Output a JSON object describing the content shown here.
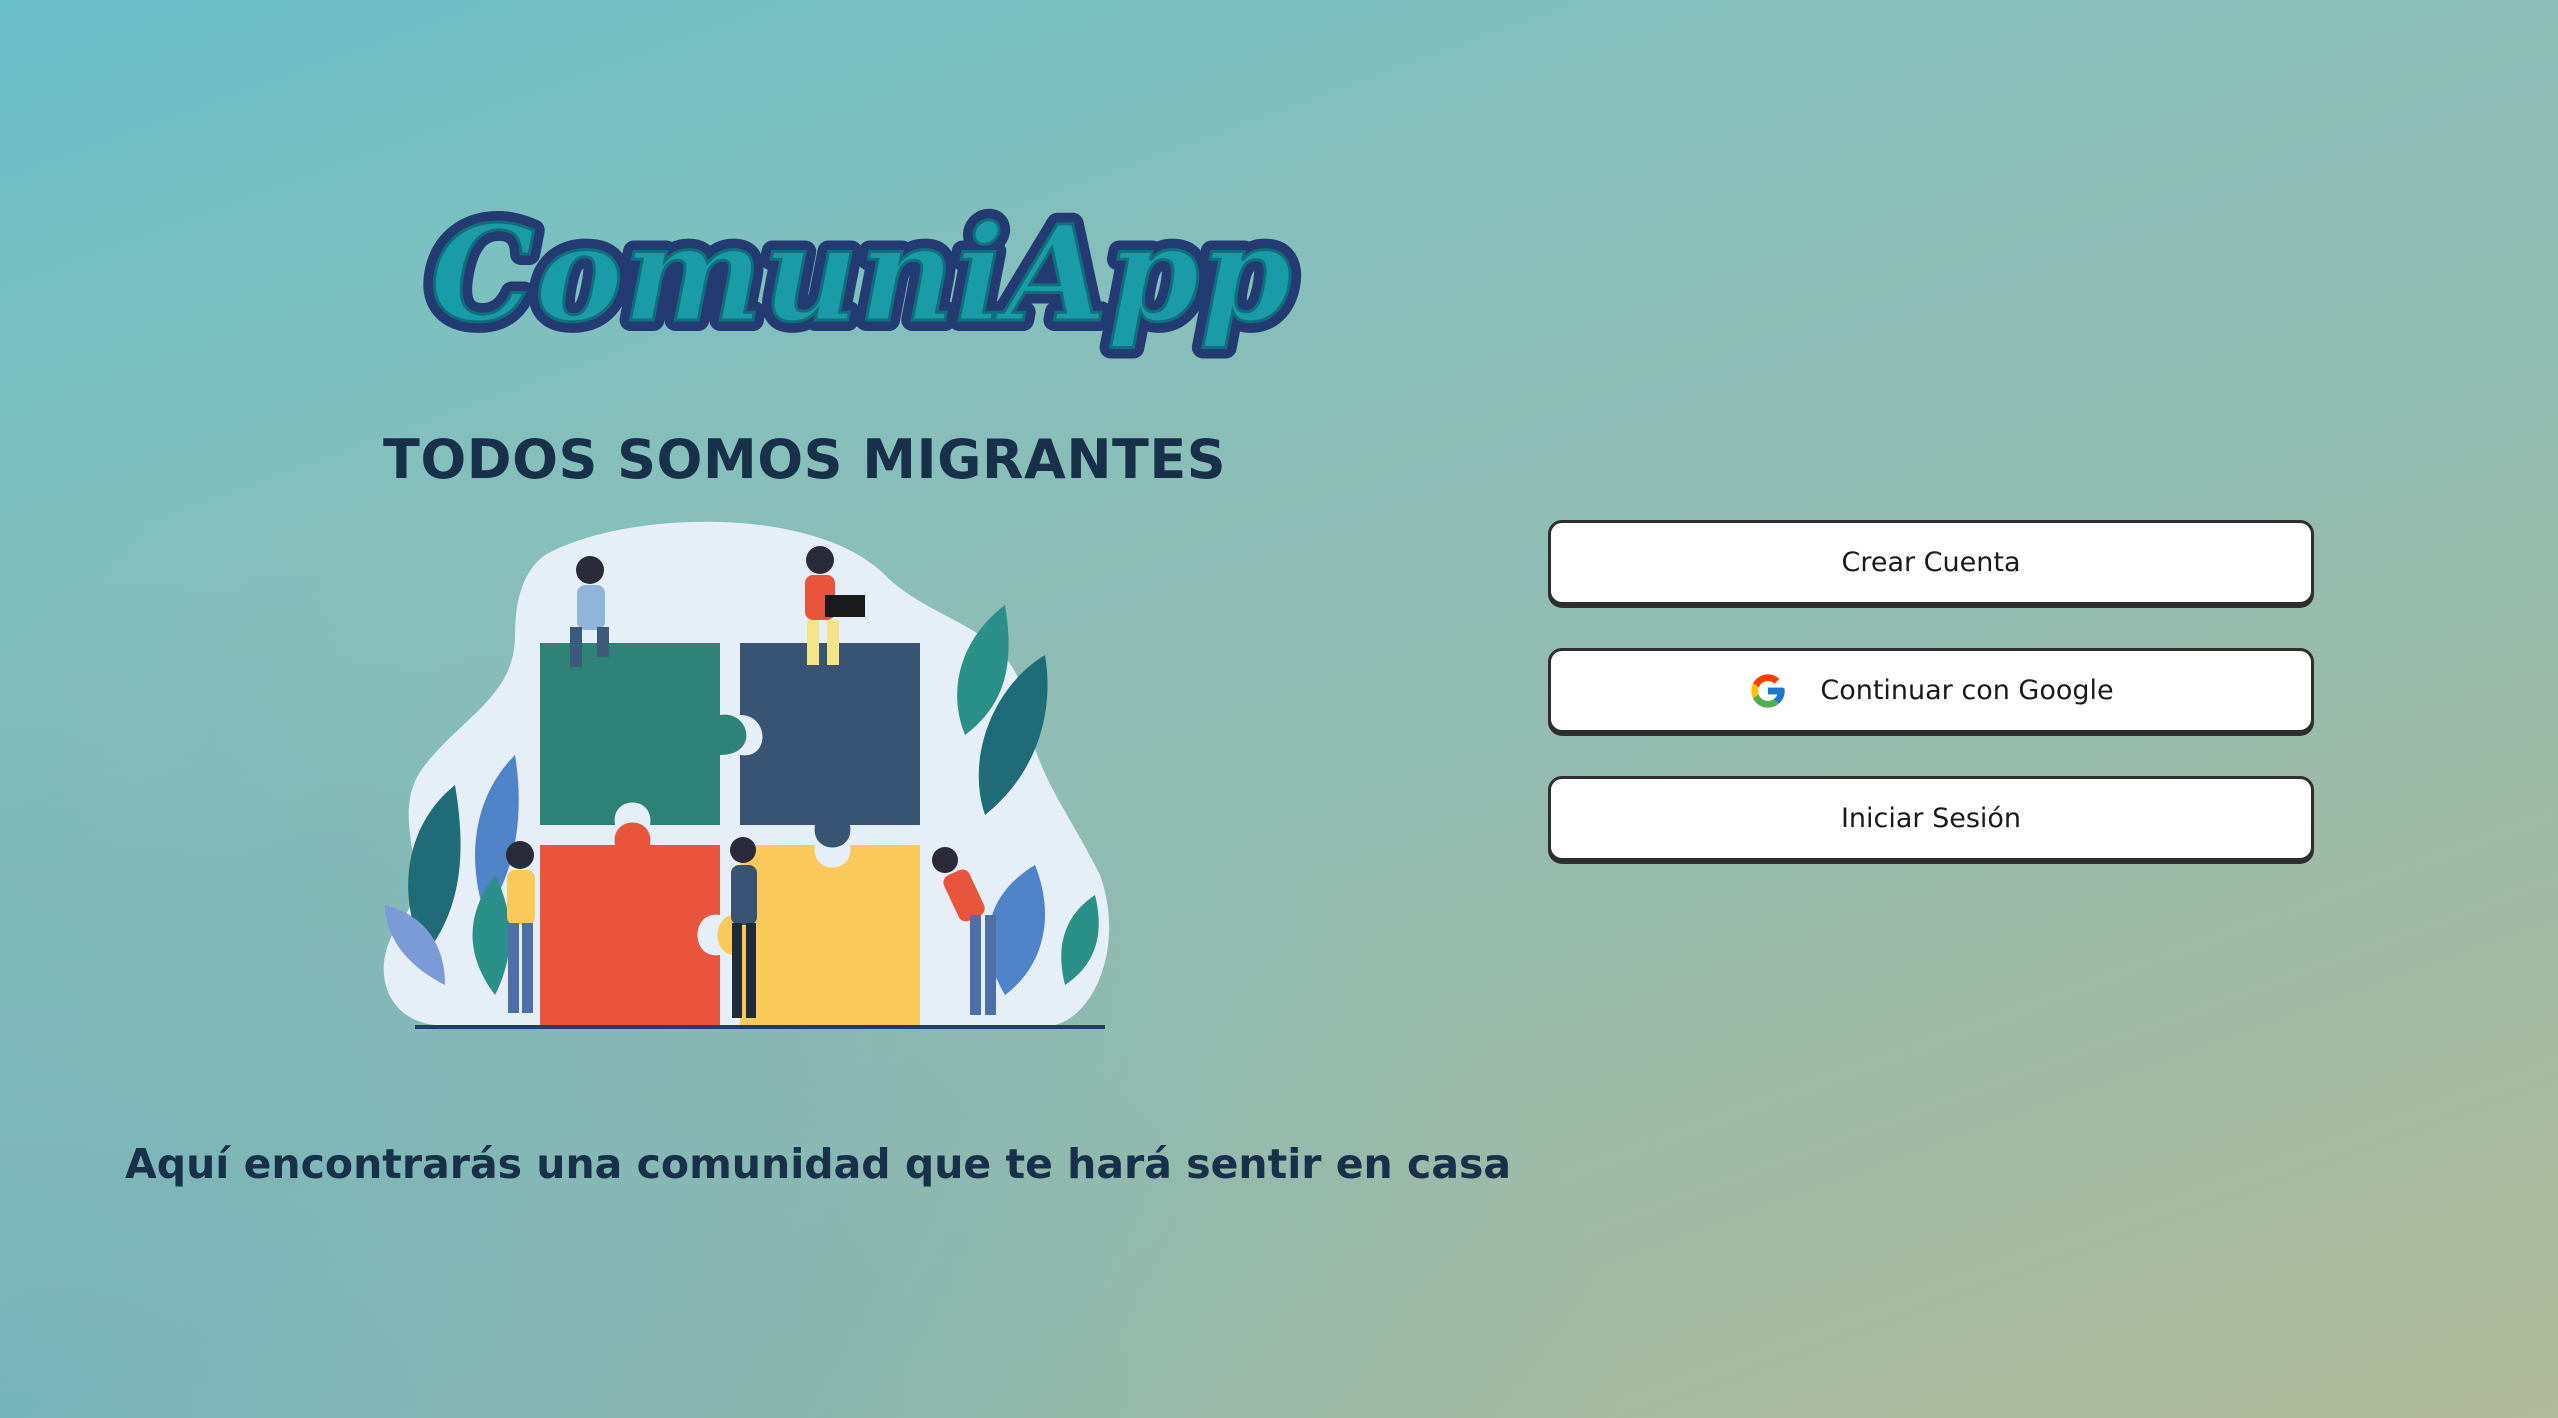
{
  "brand": {
    "logo_text": "ComuniApp",
    "tagline": "TODOS SOMOS MIGRANTES"
  },
  "hero": {
    "illustration": "puzzle-team-illustration"
  },
  "subtitle": "Aquí encontrarás una comunidad que te hará sentir en casa",
  "auth": {
    "create_account_label": "Crear Cuenta",
    "google_label": "Continuar con Google",
    "google_icon": "google-icon",
    "login_label": "Iniciar Sesión"
  },
  "colors": {
    "heading": "#18304a",
    "logo_fill": "#1a9ba8",
    "logo_outline": "#243a73",
    "button_bg": "#ffffff",
    "button_border": "#2e2e2e"
  }
}
